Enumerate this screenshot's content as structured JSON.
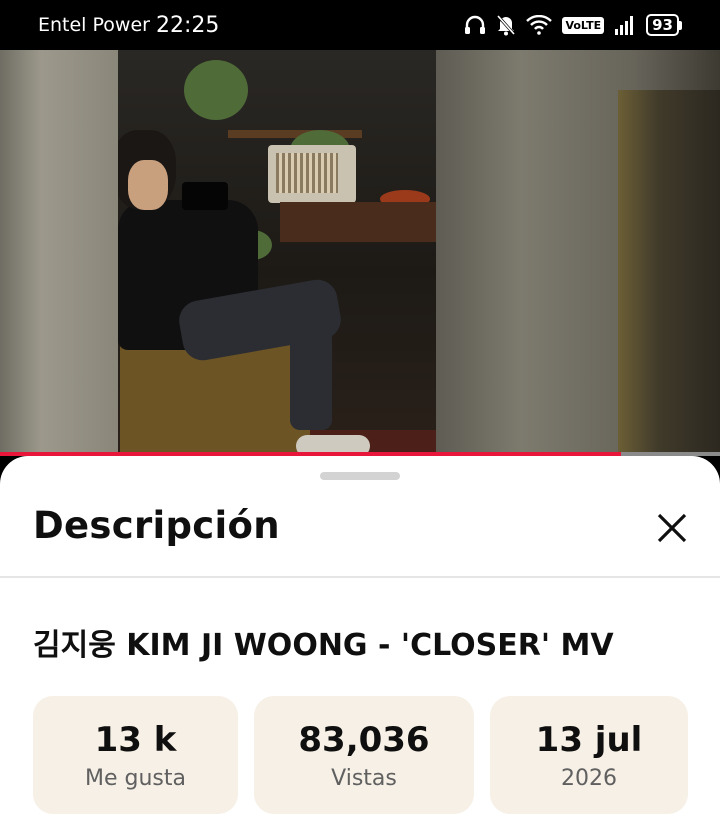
{
  "status_bar": {
    "carrier": "Entel Power",
    "time": "22:25",
    "volte": "VoLTE",
    "battery": "93",
    "icons": [
      "headphones-icon",
      "bell-off-icon",
      "wifi-icon",
      "volte-icon",
      "signal-icon",
      "battery-icon"
    ]
  },
  "player": {
    "progress_fraction": 0.862,
    "progress_color": "#e8163b"
  },
  "description_sheet": {
    "title": "Descripción",
    "close_icon": "close-icon",
    "video_title": "김지웅 KIM JI WOONG - 'CLOSER' MV",
    "stats": [
      {
        "value": "13 k",
        "label": "Me gusta"
      },
      {
        "value": "83,036",
        "label": "Vistas"
      },
      {
        "value": "13 jul",
        "label": "2026"
      }
    ]
  }
}
